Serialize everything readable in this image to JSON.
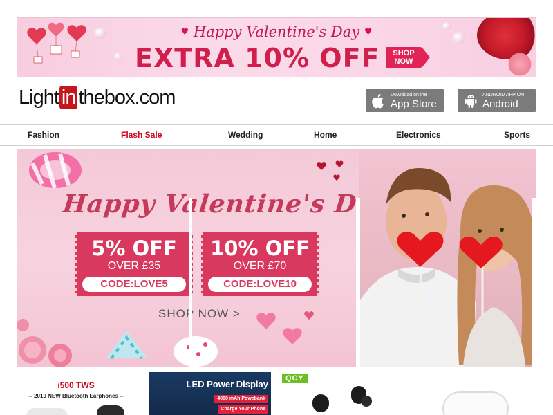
{
  "top_banner": {
    "title": "Happy Valentine's Day",
    "headline": "EXTRA 10% OFF",
    "shop_now_line1": "SHOP",
    "shop_now_line2": "NOW"
  },
  "header": {
    "logo_light": "Light",
    "logo_in": "in",
    "logo_rest": "thebox.com",
    "app_store": {
      "small": "Download on the",
      "big": "App Store"
    },
    "android": {
      "small": "ANDROID APP ON",
      "big": "Android"
    }
  },
  "nav": {
    "items": [
      "Fashion",
      "Flash Sale",
      "Wedding",
      "Home",
      "Electronics",
      "Sports"
    ]
  },
  "hero": {
    "title": "Happy Valentine's Day",
    "coupons": [
      {
        "percent": "5% OFF",
        "over": "OVER £35",
        "code": "CODE:LOVE5"
      },
      {
        "percent": "10% OFF",
        "over": "OVER £70",
        "code": "CODE:LOVE10"
      }
    ],
    "shop_now": "SHOP NOW >"
  },
  "products": {
    "p1": {
      "title": "i500 TWS",
      "subtitle": "-- 2019 NEW Bluetooth Earphones --"
    },
    "p2": {
      "title": "LED Power Display",
      "tag1": "4000 mAh Powebank",
      "tag2": "Charge Your Phone"
    },
    "p3": {
      "brand": "QCY"
    }
  },
  "colors": {
    "accent_red": "#c4161c",
    "flash_sale": "#d0021b",
    "pink_banner": "#f7cde0",
    "coupon": "#d9395e",
    "app_button": "#7b7b7b"
  }
}
